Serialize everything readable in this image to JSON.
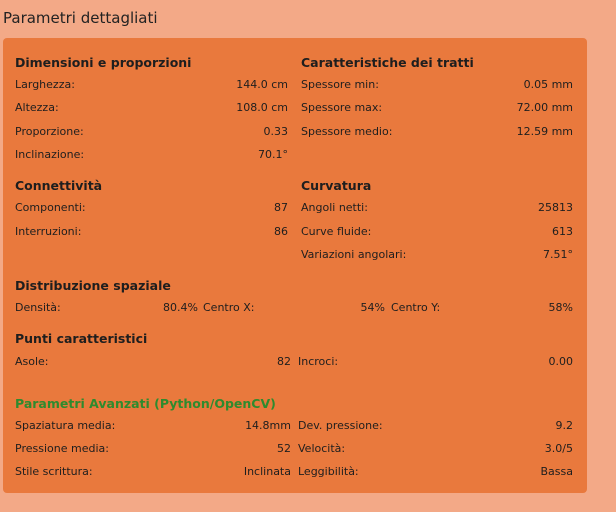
{
  "header": {
    "title": "Parametri dettagliati"
  },
  "dimensions": {
    "heading": "Dimensioni e proporzioni",
    "rows": [
      {
        "label": "Larghezza:",
        "value": "144.0 cm"
      },
      {
        "label": "Altezza:",
        "value": "108.0 cm"
      },
      {
        "label": "Proporzione:",
        "value": "0.33"
      },
      {
        "label": "Inclinazione:",
        "value": "70.1°"
      }
    ]
  },
  "strokes": {
    "heading": "Caratteristiche dei tratti",
    "rows": [
      {
        "label": "Spessore min:",
        "value": "0.05 mm"
      },
      {
        "label": "Spessore max:",
        "value": "72.00 mm"
      },
      {
        "label": "Spessore medio:",
        "value": "12.59 mm"
      }
    ]
  },
  "connectivity": {
    "heading": "Connettività",
    "rows": [
      {
        "label": "Componenti:",
        "value": "87"
      },
      {
        "label": "Interruzioni:",
        "value": "86"
      }
    ]
  },
  "curvature": {
    "heading": "Curvatura",
    "rows": [
      {
        "label": "Angoli netti:",
        "value": "25813"
      },
      {
        "label": "Curve fluide:",
        "value": "613"
      },
      {
        "label": "Variazioni angolari:",
        "value": "7.51°"
      }
    ]
  },
  "spatial": {
    "heading": "Distribuzione spaziale",
    "density_label": "Densità:",
    "density_value": "80.4%",
    "center_x_label": "Centro X:",
    "center_x_value": "54%",
    "center_y_label": "Centro Y:",
    "center_y_value": "58%"
  },
  "points": {
    "heading": "Punti caratteristici",
    "loops_label": "Asole:",
    "loops_value": "82",
    "crossings_label": "Incroci:",
    "crossings_value": "0.00"
  },
  "advanced": {
    "heading": "Parametri Avanzati (Python/OpenCV)",
    "heading_color": "#2e8b2e",
    "rows": [
      {
        "label": "Spaziatura media:",
        "value": "14.8mm",
        "label2": "Dev. pressione:",
        "value2": "9.2"
      },
      {
        "label": "Pressione media:",
        "value": "52",
        "label2": "Velocità:",
        "value2": "3.0/5"
      },
      {
        "label": "Stile scrittura:",
        "value": "Inclinata",
        "label2": "Leggibilità:",
        "value2": "Bassa"
      }
    ]
  },
  "colors": {
    "background": "#f3a987",
    "panel": "#e9793d"
  }
}
